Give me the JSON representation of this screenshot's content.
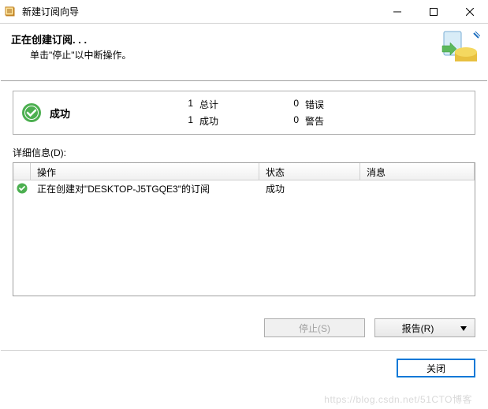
{
  "window": {
    "title": "新建订阅向导"
  },
  "header": {
    "title": "正在创建订阅. . .",
    "subtitle": "单击\"停止\"以中断操作。"
  },
  "status": {
    "label": "成功",
    "total_num": "1",
    "total_label": "总计",
    "success_num": "1",
    "success_label": "成功",
    "error_num": "0",
    "error_label": "错误",
    "warning_num": "0",
    "warning_label": "警告"
  },
  "detail_label": "详细信息(D):",
  "grid": {
    "headers": {
      "action": "操作",
      "status": "状态",
      "message": "消息"
    },
    "row": {
      "action": "正在创建对\"DESKTOP-J5TGQE3\"的订阅",
      "status": "成功",
      "message": ""
    }
  },
  "buttons": {
    "stop": "停止(S)",
    "report": "报告(R)",
    "close": "关闭"
  },
  "watermark": "https://blog.csdn.net/51CTO博客"
}
